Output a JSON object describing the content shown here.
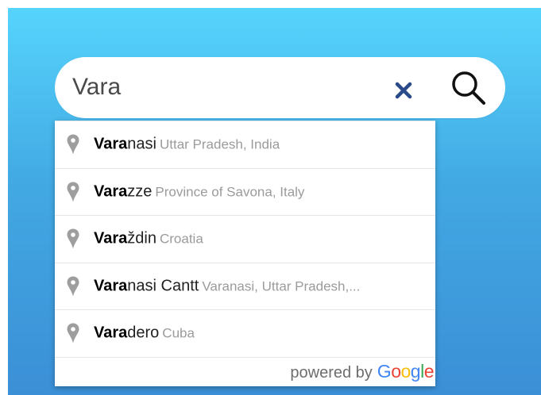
{
  "search": {
    "value": "Vara",
    "placeholder": ""
  },
  "suggestions": [
    {
      "match": "Vara",
      "rest": "nasi",
      "secondary": "Uttar Pradesh, India"
    },
    {
      "match": "Vara",
      "rest": "zze",
      "secondary": "Province of Savona, Italy"
    },
    {
      "match": "Vara",
      "rest": "ždin",
      "secondary": "Croatia"
    },
    {
      "match": "Vara",
      "rest": "nasi Cantt",
      "secondary": "Varanasi, Uttar Pradesh,..."
    },
    {
      "match": "Vara",
      "rest": "dero",
      "secondary": "Cuba"
    }
  ],
  "footer": {
    "powered_by": "powered by",
    "brand_letters": [
      "G",
      "o",
      "o",
      "g",
      "l",
      "e"
    ]
  },
  "icons": {
    "clear": "close-icon",
    "search": "search-icon",
    "pin": "map-pin-icon"
  },
  "colors": {
    "background_top": "#56d4fd",
    "background_bottom": "#3b8fd6",
    "clear_icon": "#2b4a8a",
    "pin": "#9e9e9e",
    "secondary_text": "#9b9b9b",
    "google_blue": "#4285F4",
    "google_red": "#EA4335",
    "google_yellow": "#FBBC05",
    "google_green": "#34A853"
  }
}
